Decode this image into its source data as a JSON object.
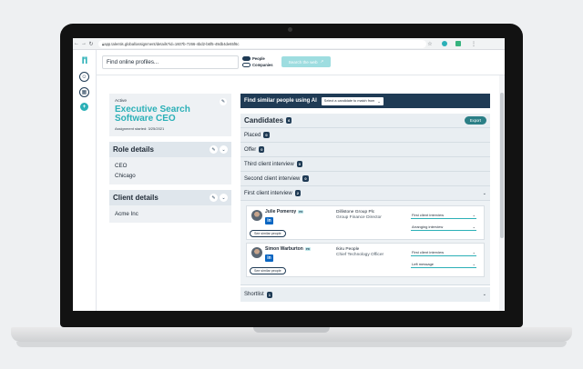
{
  "browser": {
    "url": "app.talentis.global/assignment/details?id=1607b-7266-4bd2-b6f5-49db4de65f6c"
  },
  "topbar": {
    "search_placeholder": "Find online profiles...",
    "toggle_people": "People",
    "toggle_companies": "Companies",
    "search_web_label": "Search the web"
  },
  "assignment": {
    "status": "Active",
    "title": "Executive Search Software CEO",
    "started": "Assignment started: 3/25/2021"
  },
  "role_details": {
    "heading": "Role details",
    "items": [
      "CEO",
      "Chicago"
    ]
  },
  "client_details": {
    "heading": "Client details",
    "items": [
      "Acme Inc"
    ]
  },
  "ai": {
    "heading": "Find similar people using AI",
    "select_label": "Select a candidate to match from"
  },
  "candidates": {
    "heading": "Candidates",
    "count": "6",
    "export_label": "Export",
    "stages": [
      {
        "label": "Placed",
        "count": "0"
      },
      {
        "label": "Offer",
        "count": "0"
      },
      {
        "label": "Third client interview",
        "count": "0"
      },
      {
        "label": "Second client interview",
        "count": "0"
      },
      {
        "label": "First client interview",
        "count": "2"
      }
    ],
    "people": [
      {
        "name": "Julie Pomeroy",
        "tag": "PD",
        "company": "Dillistone Group Plc",
        "role": "Group Finance Director",
        "stage": "First client interview",
        "status": "Arranging interview",
        "similar": "See similar people"
      },
      {
        "name": "Simon Warburton",
        "tag": "PD",
        "company": "Ikiru People",
        "role": "Chief Technology Officer",
        "stage": "First client interview",
        "status": "Left message",
        "similar": "See similar people"
      }
    ],
    "shortlist": {
      "label": "Shortlist",
      "count": "1"
    }
  },
  "icons": {
    "logo": "talentis-logo",
    "rail": [
      "user-icon",
      "building-icon",
      "plus-icon"
    ]
  }
}
